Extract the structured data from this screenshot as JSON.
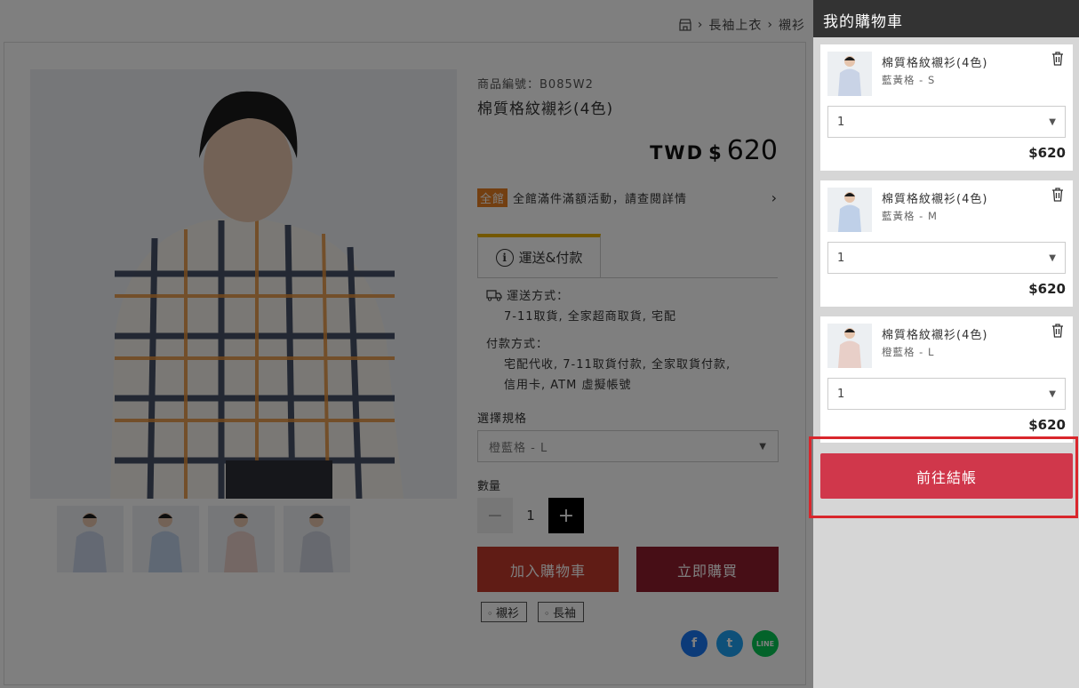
{
  "breadcrumb": [
    "長袖上衣",
    "襯衫"
  ],
  "product": {
    "sku": "商品編號：B085W2",
    "name": "棉質格紋襯衫(4色)",
    "currency": "TWD",
    "price_symbol": "$",
    "price": "620"
  },
  "promo": {
    "badge": "全館",
    "text": "全館滿件滿額活動，請查閱詳情"
  },
  "tab": {
    "label": "運送&付款"
  },
  "shipping": {
    "method_label": "運送方式：",
    "method_value": "7-11取貨, 全家超商取貨, 宅配",
    "pay_label": "付款方式：",
    "pay_value_1": "宅配代收, 7-11取貨付款, 全家取貨付款,",
    "pay_value_2": "信用卡, ATM 虛擬帳號"
  },
  "spec": {
    "label": "選擇規格",
    "selected": "橙藍格 - L"
  },
  "quantity": {
    "label": "數量",
    "value": "1",
    "minus": "−",
    "plus": "+"
  },
  "buttons": {
    "add_to_cart": "加入購物車",
    "buy_now": "立即購買"
  },
  "tags": [
    "襯衫",
    "長袖"
  ],
  "social": {
    "facebook": "f",
    "twitter": "t",
    "line": "LINE"
  },
  "colors": {
    "accent_tab": "#e8b100",
    "promo_badge": "#e67e22",
    "checkout": "#d0374b",
    "highlight": "#d9262c"
  },
  "cart": {
    "title": "我的購物車",
    "items": [
      {
        "name": "棉質格紋襯衫(4色)",
        "variant": "藍黃格 - S",
        "qty": "1",
        "price": "$620"
      },
      {
        "name": "棉質格紋襯衫(4色)",
        "variant": "藍黃格 - M",
        "qty": "1",
        "price": "$620"
      },
      {
        "name": "棉質格紋襯衫(4色)",
        "variant": "橙藍格 - L",
        "qty": "1",
        "price": "$620"
      }
    ],
    "checkout_label": "前往結帳"
  }
}
